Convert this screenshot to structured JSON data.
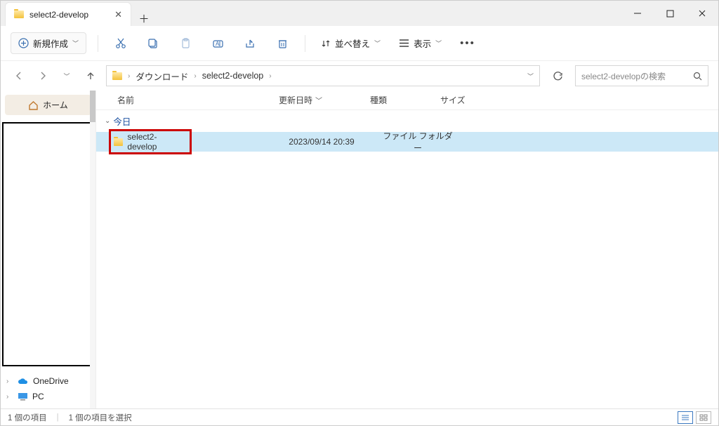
{
  "window": {
    "tab_title": "select2-develop"
  },
  "ribbon": {
    "new_label": "新規作成",
    "sort_label": "並べ替え",
    "view_label": "表示"
  },
  "breadcrumb": {
    "items": [
      "ダウンロード",
      "select2-develop"
    ]
  },
  "search": {
    "placeholder": "select2-developの検索"
  },
  "sidebar": {
    "home": "ホーム",
    "onedrive": "OneDrive",
    "pc": "PC"
  },
  "columns": {
    "name": "名前",
    "date": "更新日時",
    "type": "種類",
    "size": "サイズ"
  },
  "group": {
    "today": "今日"
  },
  "files": [
    {
      "name": "select2-develop",
      "date": "2023/09/14 20:39",
      "type": "ファイル フォルダー",
      "size": ""
    }
  ],
  "status": {
    "count": "1 個の項目",
    "selected": "1 個の項目を選択"
  }
}
